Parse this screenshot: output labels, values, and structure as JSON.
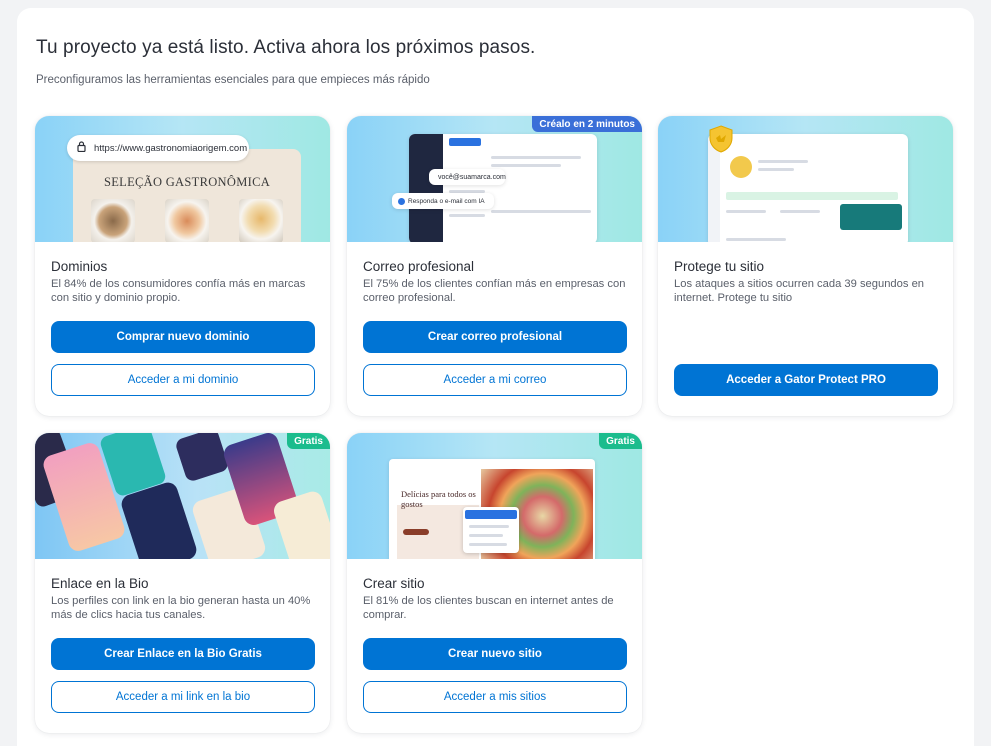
{
  "header": {
    "title": "Tu proyecto ya está listo. Activa ahora los próximos pasos.",
    "subtitle": "Preconfiguramos las herramientas esenciales para que empieces más rápido"
  },
  "cards": [
    {
      "title": "Dominios",
      "description": "El 84% de los consumidores confía más en marcas con sitio y dominio propio.",
      "primary_label": "Comprar nuevo dominio",
      "secondary_label": "Acceder a mi dominio",
      "hero": {
        "url": "https://www.gastronomiaorigem.com",
        "site_heading": "SELEÇÃO GASTRONÔMICA"
      }
    },
    {
      "title": "Correo profesional",
      "description": "El 75% de los clientes confían más en empresas con correo profesional.",
      "primary_label": "Crear correo profesional",
      "secondary_label": "Acceder a mi correo",
      "badge": "Créalo en 2 minutos",
      "hero": {
        "email_chip": "você@suamarca.com",
        "reply_chip": "Responda o e-mail com IA"
      }
    },
    {
      "title": "Protege tu sitio",
      "description": "Los ataques a sitios ocurren cada 39 segundos en internet. Protege tu sitio",
      "primary_label": "Acceder a Gator Protect PRO"
    },
    {
      "title": "Enlace en la Bio",
      "description": "Los perfiles con link en la bio generan hasta un 40% más de clics hacia tus canales.",
      "primary_label": "Crear Enlace en la Bio Gratis",
      "secondary_label": "Acceder a mi link en la bio",
      "badge": "Gratis"
    },
    {
      "title": "Crear sitio",
      "description": "El 81% de los clientes buscan en internet antes de comprar.",
      "primary_label": "Crear nuevo sitio",
      "secondary_label": "Acceder a mis sitios",
      "badge": "Gratis",
      "hero": {
        "site_heading": "Delícias para todos os gostos"
      }
    }
  ],
  "colors": {
    "primary": "#0074d4",
    "badge_blue": "#3a6fd8",
    "badge_green": "#1bbc8d"
  }
}
